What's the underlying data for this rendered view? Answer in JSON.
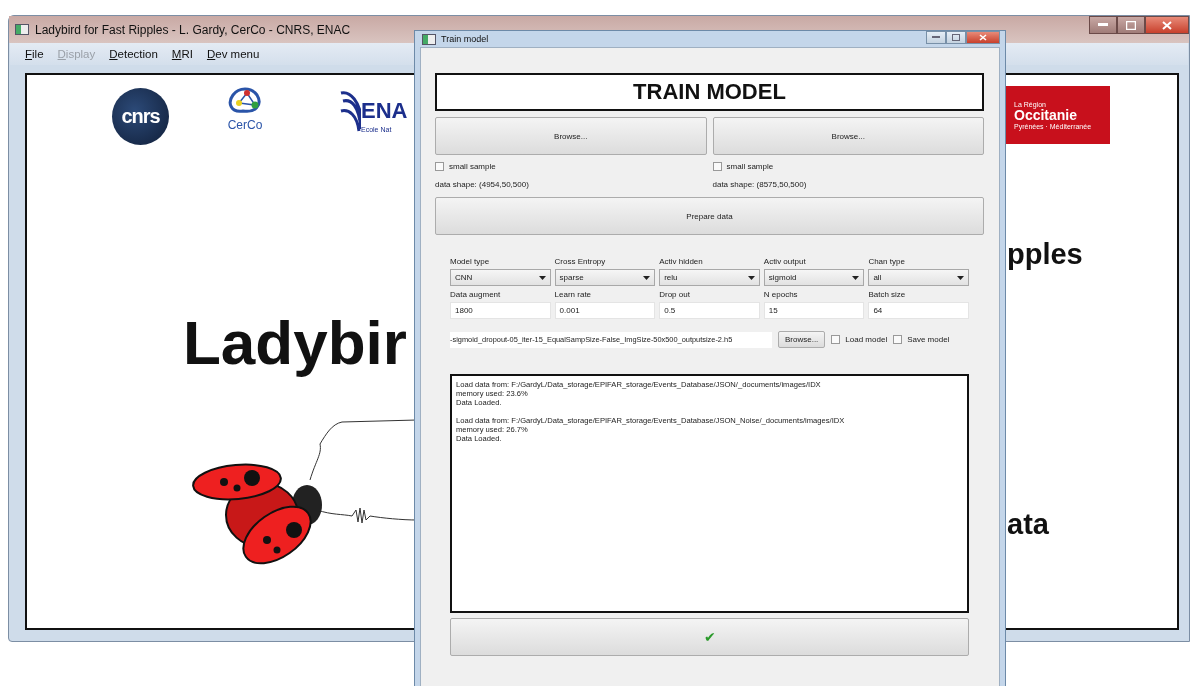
{
  "main_window": {
    "title": "Ladybird for Fast Ripples - L. Gardy, CerCo - CNRS, ENAC",
    "menu": [
      {
        "label": "File",
        "disabled": false
      },
      {
        "label": "Display",
        "disabled": true
      },
      {
        "label": "Detection",
        "disabled": false
      },
      {
        "label": "MRI",
        "disabled": false
      },
      {
        "label": "Dev menu",
        "disabled": false
      }
    ],
    "logos": {
      "cnrs": "cnrs",
      "cerco": "CerCo",
      "enac": "ENA",
      "enac_sub": "Ecole Nat",
      "region_top": "La Région",
      "region_name": "Occitanie",
      "region_sub": "Pyrénées · Méditerranée"
    },
    "headline": "Ladybir",
    "right_text_1": "pples",
    "right_text_2": "ata"
  },
  "dialog": {
    "title": "Train model",
    "heading": "TRAIN MODEL",
    "sources": [
      {
        "button": "Browse...",
        "small_sample": {
          "label": "small sample",
          "checked": false
        },
        "data_shape": "data shape: (4954,50,500)"
      },
      {
        "button": "Browse...",
        "small_sample": {
          "label": "small sample",
          "checked": false
        },
        "data_shape": "data shape: (8575,50,500)"
      }
    ],
    "prepare_button": "Prepare data",
    "params": [
      {
        "label": "Model type",
        "kind": "select",
        "value": "CNN"
      },
      {
        "label": "Cross Entropy",
        "kind": "select",
        "value": "sparse"
      },
      {
        "label": "Activ hidden",
        "kind": "select",
        "value": "relu"
      },
      {
        "label": "Activ output",
        "kind": "select",
        "value": "sigmoid"
      },
      {
        "label": "Chan type",
        "kind": "select",
        "value": "all"
      },
      {
        "label": "Data augment",
        "kind": "input",
        "value": "1800"
      },
      {
        "label": "Learn rate",
        "kind": "input",
        "value": "0.001"
      },
      {
        "label": "Drop out",
        "kind": "input",
        "value": "0.5"
      },
      {
        "label": "N epochs",
        "kind": "input",
        "value": "15"
      },
      {
        "label": "Batch size",
        "kind": "input",
        "value": "64"
      }
    ],
    "model_path": "-sigmoid_dropout-05_iter-15_EqualSampSize-False_ImgSize-50x500_outputsize-2.h5",
    "model_browse": "Browse...",
    "options": [
      {
        "label": "Load model",
        "checked": false
      },
      {
        "label": "Save model",
        "checked": false
      }
    ],
    "log": [
      [
        "Load data from: F:/GardyL/Data_storage/EPIFAR_storage/Events_Database/JSON/_documents/images/IDX",
        "memory used: 23.6%",
        "Data Loaded."
      ],
      [
        "Load data from: F:/GardyL/Data_storage/EPIFAR_storage/Events_Database/JSON_Noise/_documents/images/IDX",
        "memory used: 26.7%",
        "Data Loaded."
      ]
    ],
    "confirm": "✔"
  }
}
